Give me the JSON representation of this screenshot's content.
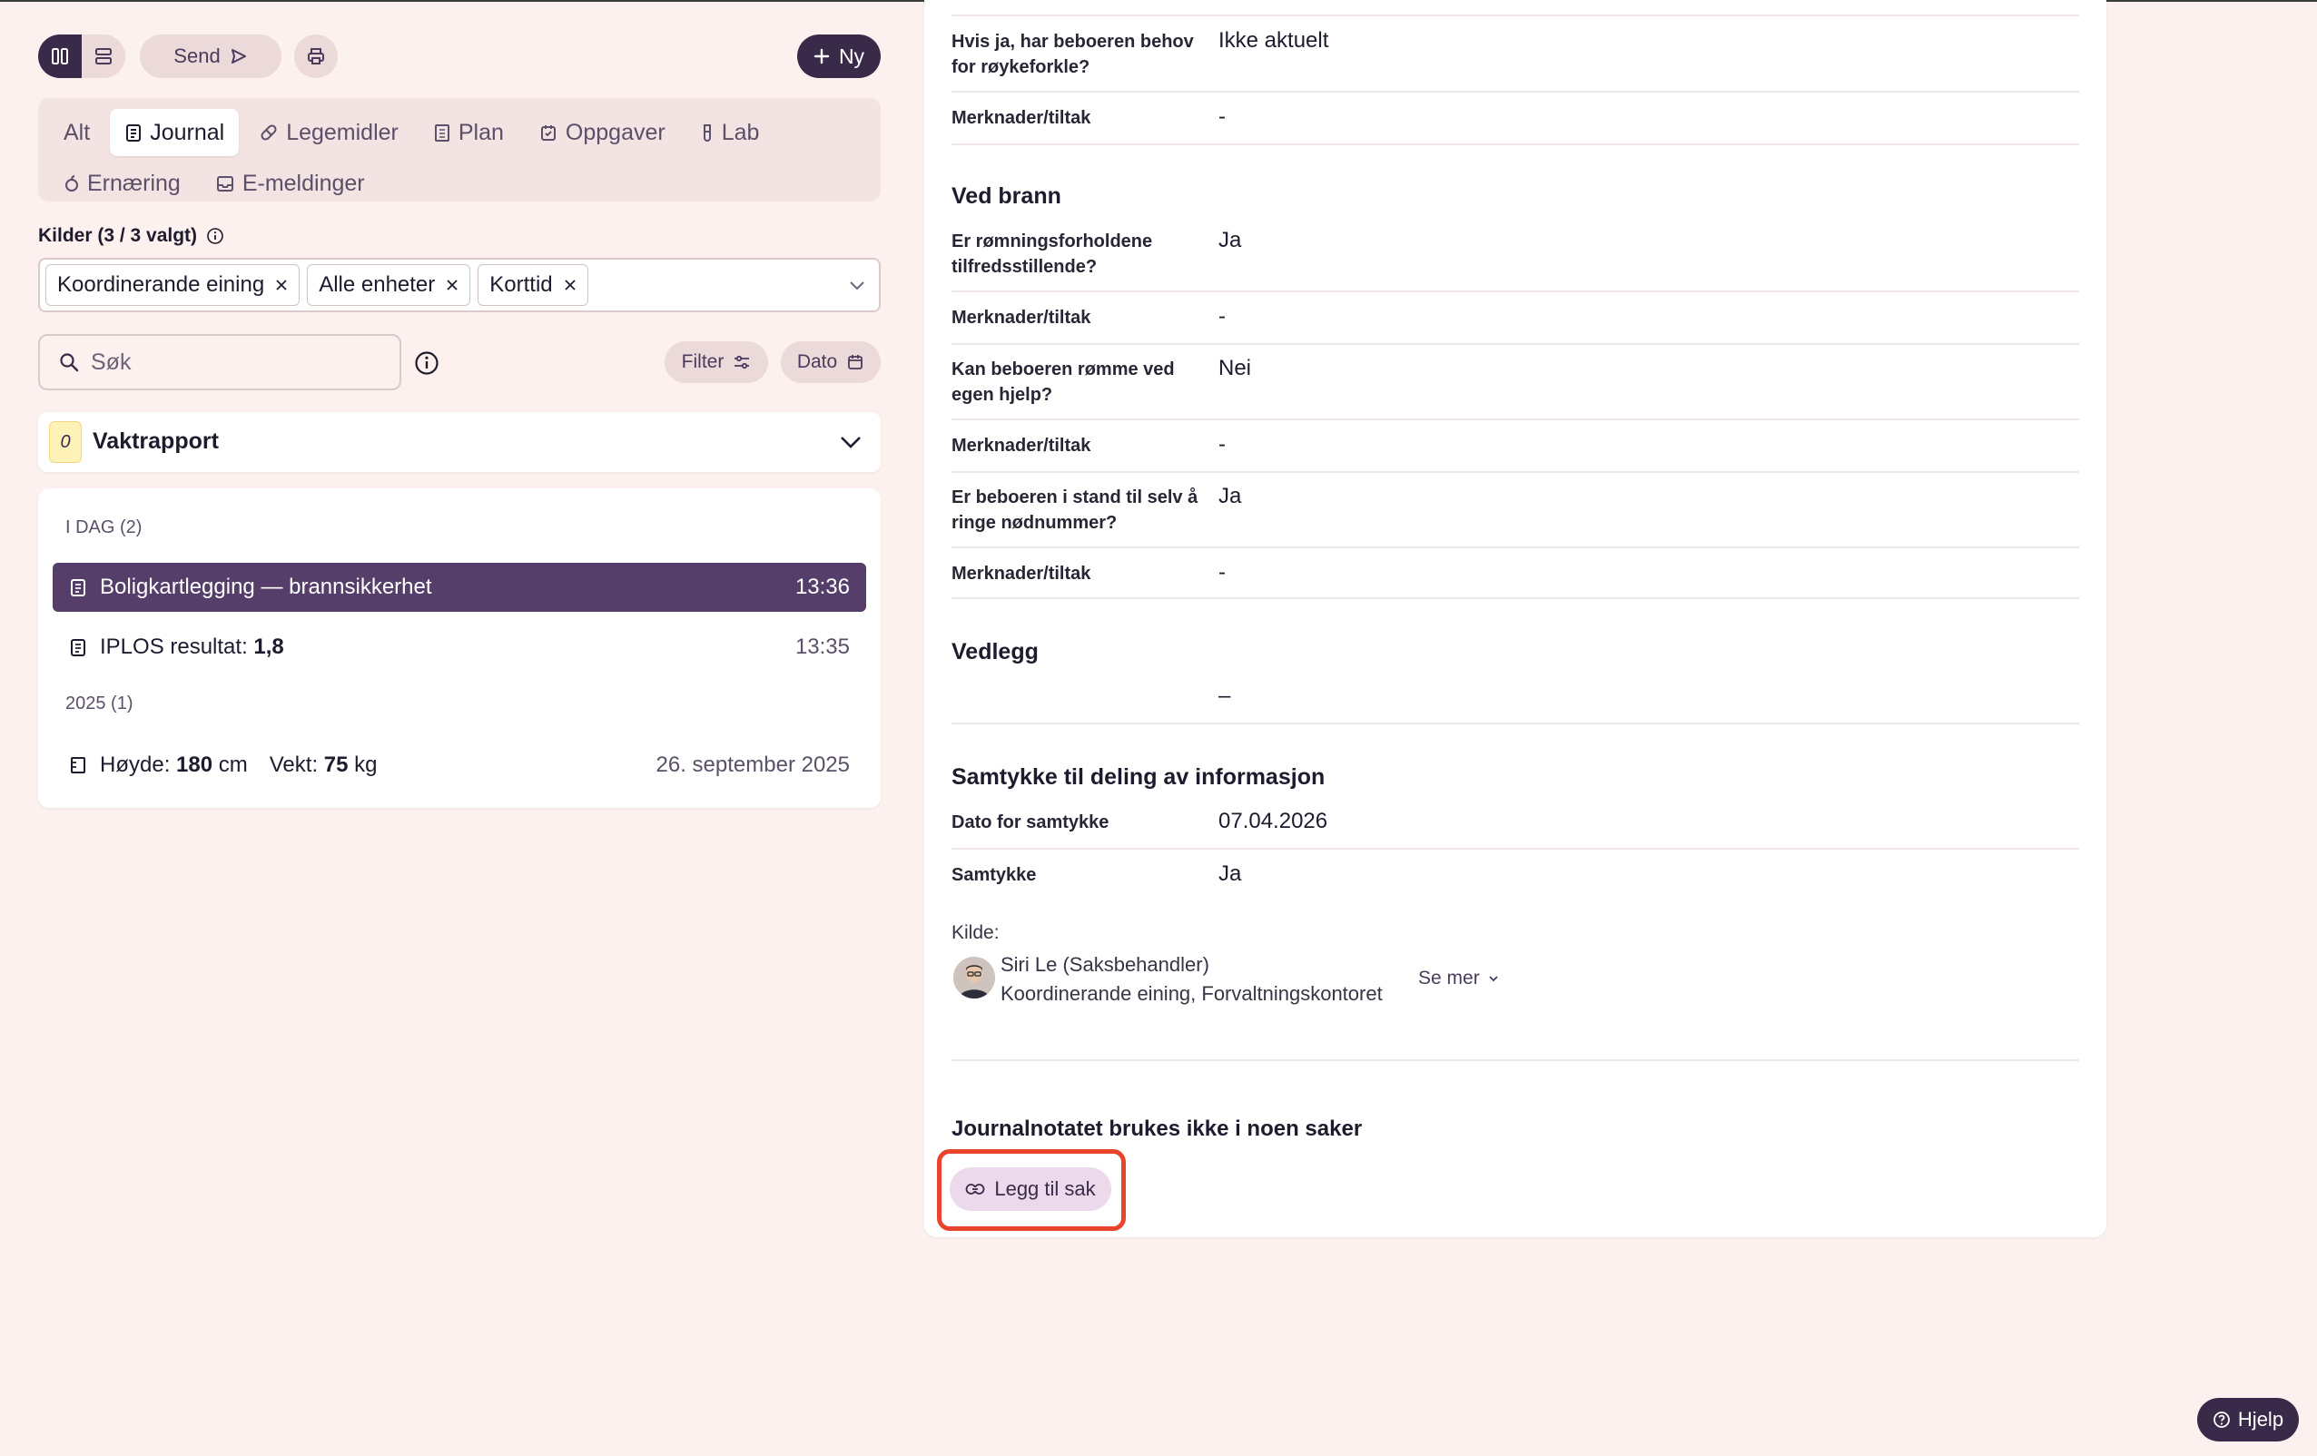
{
  "toolbar": {
    "send_label": "Send",
    "new_label": "Ny"
  },
  "tabs": [
    {
      "label": "Alt",
      "icon": ""
    },
    {
      "label": "Journal",
      "icon": "journal-icon"
    },
    {
      "label": "Legemidler",
      "icon": "pill-icon"
    },
    {
      "label": "Plan",
      "icon": "plan-icon"
    },
    {
      "label": "Oppgaver",
      "icon": "tasks-icon"
    },
    {
      "label": "Lab",
      "icon": "test-tube-icon"
    },
    {
      "label": "Ernæring",
      "icon": "apple-icon"
    },
    {
      "label": "E-meldinger",
      "icon": "inbox-icon"
    }
  ],
  "sources": {
    "label": "Kilder (3 / 3 valgt)",
    "chips": [
      "Koordinerande eining",
      "Alle enheter",
      "Korttid"
    ]
  },
  "search": {
    "placeholder": "Søk",
    "filter_label": "Filter",
    "date_label": "Dato"
  },
  "vaktrapport": {
    "badge": "0",
    "title": "Vaktrapport"
  },
  "list": {
    "group_today": "I DAG (2)",
    "group_2025": "2025 (1)",
    "items": [
      {
        "title": "Boligkartlegging — brannsikkerhet",
        "time": "13:36"
      },
      {
        "title_prefix": "IPLOS resultat: ",
        "title_value": "1,8",
        "time": "13:35"
      },
      {
        "height_label": "Høyde: ",
        "height_value": "180",
        "height_unit": " cm",
        "weight_label": "Vekt: ",
        "weight_value": "75",
        "weight_unit": " kg",
        "time": "26. september 2025"
      }
    ]
  },
  "detail": {
    "rows_top": [
      {
        "q": "Hvis ja, har beboeren behov for røykeforkle?",
        "a": "Ikke aktuelt"
      },
      {
        "q": "Merknader/tiltak",
        "a": "-"
      }
    ],
    "section_brann": "Ved brann",
    "rows_brann": [
      {
        "q": "Er rømningsforholdene tilfredsstillende?",
        "a": "Ja"
      },
      {
        "q": "Merknader/tiltak",
        "a": "-"
      },
      {
        "q": "Kan beboeren rømme ved egen hjelp?",
        "a": "Nei"
      },
      {
        "q": "Merknader/tiltak",
        "a": "-"
      },
      {
        "q": "Er beboeren i stand til selv å ringe nødnummer?",
        "a": "Ja"
      },
      {
        "q": "Merknader/tiltak",
        "a": "-"
      }
    ],
    "section_vedlegg": "Vedlegg",
    "vedlegg_value": "–",
    "section_samtykke": "Samtykke til deling av informasjon",
    "rows_samtykke": [
      {
        "q": "Dato for samtykke",
        "a": "07.04.2026"
      },
      {
        "q": "Samtykke",
        "a": "Ja"
      }
    ],
    "kilde_label": "Kilde:",
    "person_name": "Siri Le (Saksbehandler)",
    "person_org": "Koordinerande eining, Forvaltningskontoret",
    "se_mer": "Se mer",
    "journal_note": "Journalnotatet brukes ikke i noen saker",
    "add_case_label": "Legg til sak"
  },
  "help_label": "Hjelp",
  "colors": {
    "accent": "#3a2a49",
    "selected_row": "#553f6a",
    "highlight": "#e8452c",
    "background": "#fcf1ee"
  }
}
